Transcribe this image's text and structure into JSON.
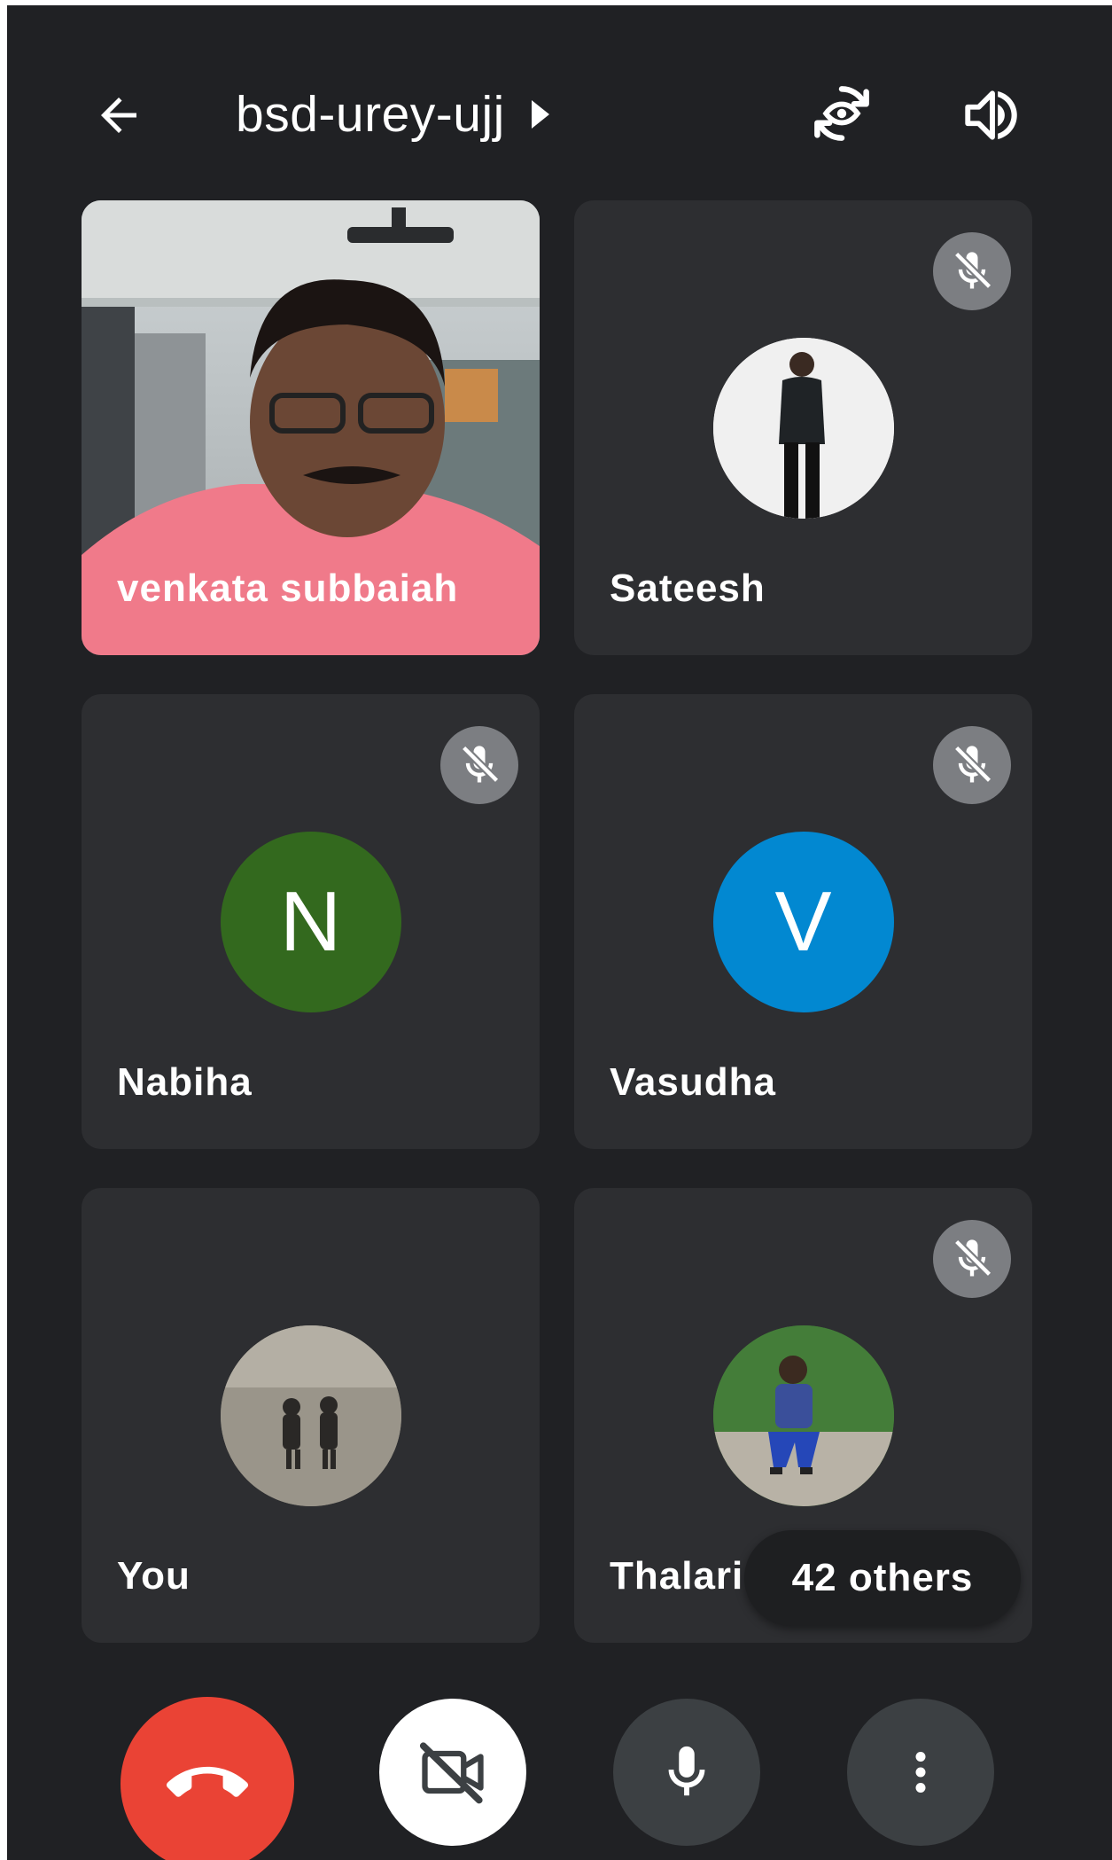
{
  "header": {
    "meeting_code": "bsd-urey-ujj",
    "back_icon": "arrow-back-icon",
    "switch_camera_icon": "camera-switch-icon",
    "audio_output_icon": "speaker-icon"
  },
  "participants": [
    {
      "name": "venkata subbaiah",
      "video": true,
      "muted": false
    },
    {
      "name": "Sateesh",
      "video": false,
      "muted": true,
      "avatar": "photo"
    },
    {
      "name": "Nabiha",
      "video": false,
      "muted": true,
      "avatar_letter": "N",
      "avatar_color": "#33691e"
    },
    {
      "name": "Vasudha",
      "video": false,
      "muted": true,
      "avatar_letter": "V",
      "avatar_color": "#0288d1"
    },
    {
      "name": "You",
      "video": false,
      "muted": false,
      "avatar": "photo"
    },
    {
      "name": "Thalari",
      "video": false,
      "muted": true,
      "avatar": "photo"
    }
  ],
  "others_count_label": "42 others",
  "controls": {
    "end_call_icon": "phone-hangup-icon",
    "end_call_color": "#ea4335",
    "camera_icon": "video-off-icon",
    "mic_icon": "microphone-icon",
    "more_icon": "more-vertical-icon"
  }
}
